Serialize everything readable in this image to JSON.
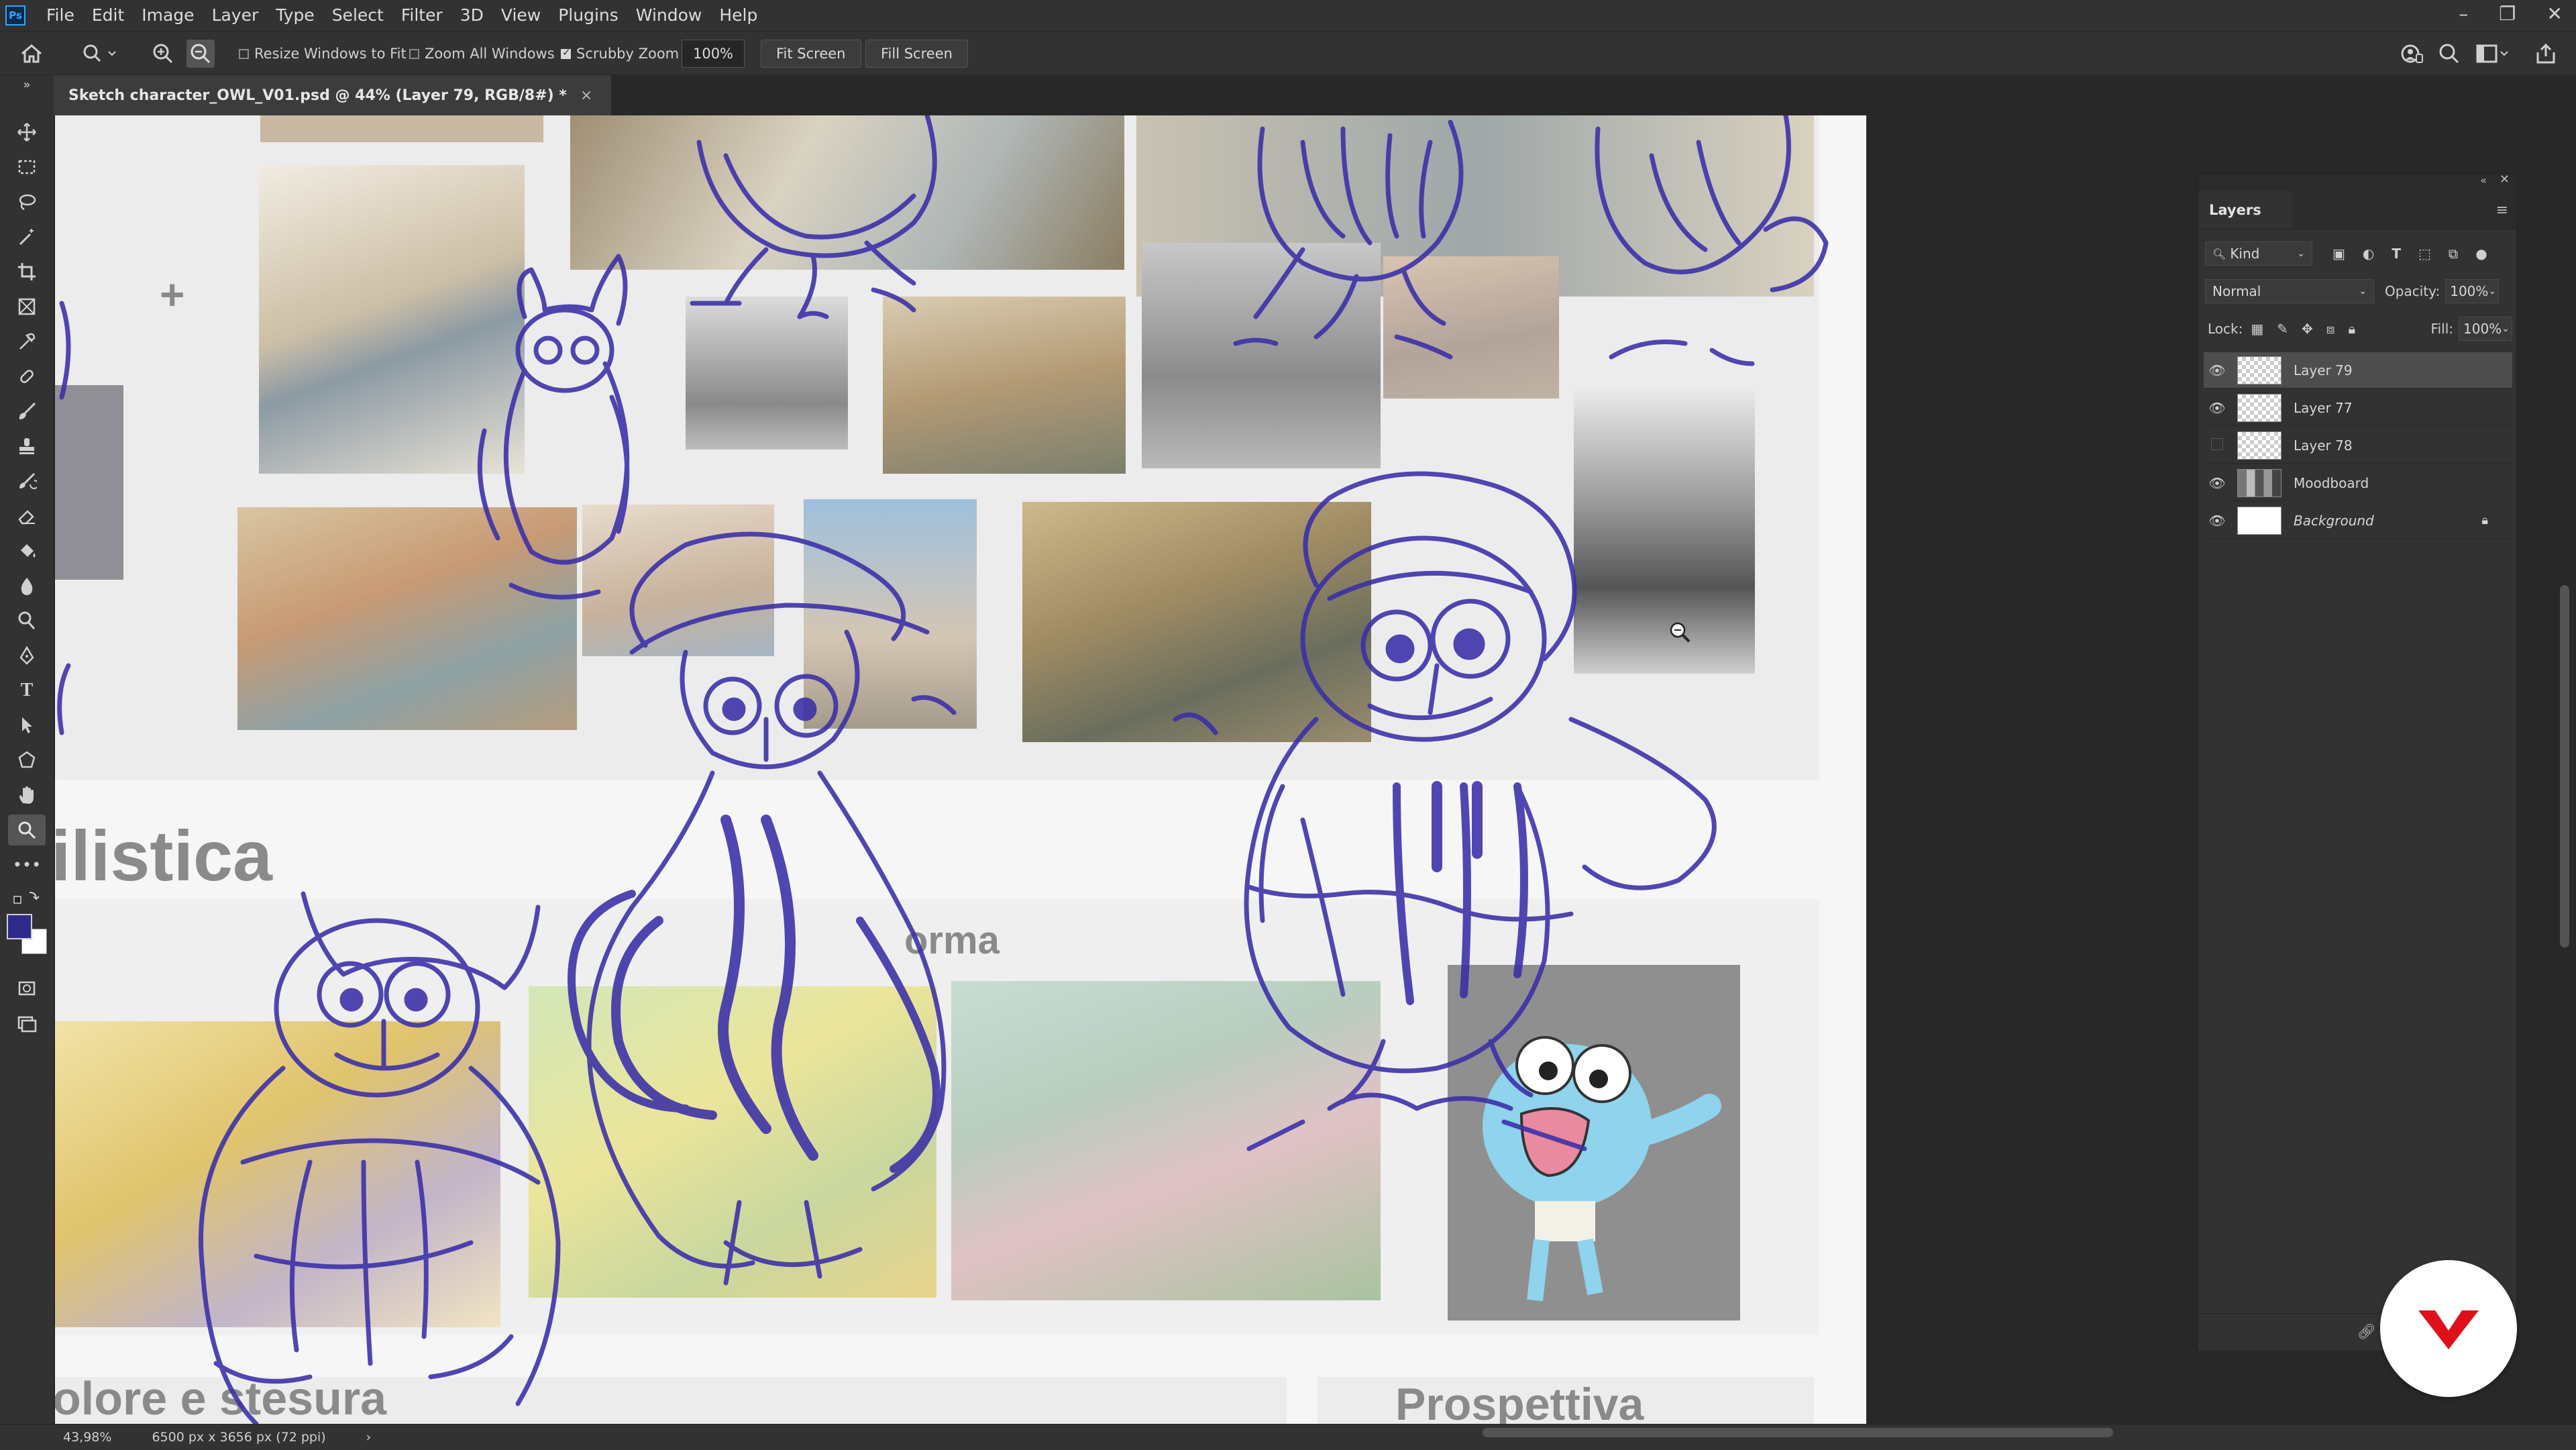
{
  "app": {
    "logo_text": "Ps"
  },
  "menu": [
    "File",
    "Edit",
    "Image",
    "Layer",
    "Type",
    "Select",
    "Filter",
    "3D",
    "View",
    "Plugins",
    "Window",
    "Help"
  ],
  "window_controls": {
    "minimize": "–",
    "restore": "❐",
    "close": "✕"
  },
  "options_bar": {
    "resize_windows_label": "Resize Windows to Fit",
    "resize_windows_checked": false,
    "zoom_all_label": "Zoom All Windows",
    "zoom_all_checked": false,
    "scrubby_zoom_label": "Scrubby Zoom",
    "scrubby_zoom_checked": true,
    "zoom_value": "100%",
    "fit_screen_label": "Fit Screen",
    "fill_screen_label": "Fill Screen"
  },
  "document": {
    "tab_title": "Sketch character_OWL_V01.psd @ 44% (Layer 79, RGB/8#) *",
    "close_glyph": "×"
  },
  "canvas_text": {
    "heading_stilistica": "ilistica",
    "heading_forma": "orma",
    "heading_colore": "olore e stesura",
    "heading_prospettiva": "Prospettiva",
    "plus": "+"
  },
  "layers_panel": {
    "tab_label": "Layers",
    "filter_kind": "Kind",
    "blend_mode": "Normal",
    "opacity_label": "Opacity:",
    "opacity_value": "100%",
    "lock_label": "Lock:",
    "fill_label": "Fill:",
    "fill_value": "100%",
    "layers": [
      {
        "name": "Layer 79",
        "visible": true,
        "active": true
      },
      {
        "name": "Layer 77",
        "visible": true,
        "active": false
      },
      {
        "name": "Layer 78",
        "visible": false,
        "active": false
      },
      {
        "name": "Moodboard",
        "visible": true,
        "active": false
      },
      {
        "name": "Background",
        "visible": true,
        "active": false,
        "locked": true
      }
    ]
  },
  "status_bar": {
    "zoom": "43,98%",
    "doc_size": "6500 px x 3656 px (72 ppi)",
    "arrow": "›"
  },
  "colors": {
    "foreground": "#2e2a8c",
    "background": "#ffffff",
    "sketch_stroke": "#3a2ea8",
    "ui_dark": "#323232"
  }
}
